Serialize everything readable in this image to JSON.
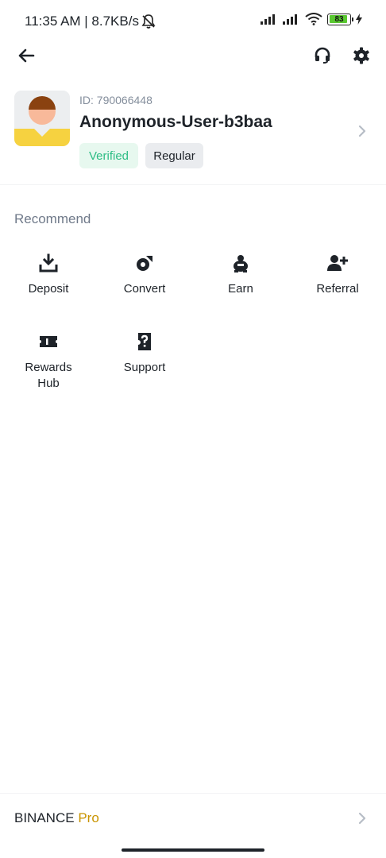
{
  "status_bar": {
    "time": "11:35 AM | 8.7KB/s",
    "battery_level": "83",
    "icons": [
      "mute-bell-icon",
      "signal-icon",
      "signal-icon",
      "wifi-icon",
      "battery-icon",
      "charging-icon"
    ]
  },
  "topbar": {
    "icons": [
      "back-arrow-icon",
      "headset-icon",
      "gear-icon"
    ]
  },
  "profile": {
    "id_text": "ID: 790066448",
    "username": "Anonymous-User-b3baa",
    "badges": [
      "Verified",
      "Regular"
    ]
  },
  "recommend": {
    "title": "Recommend",
    "items": [
      {
        "label": "Deposit",
        "icon": "deposit-icon"
      },
      {
        "label": "Convert",
        "icon": "convert-icon"
      },
      {
        "label": "Earn",
        "icon": "earn-icon"
      },
      {
        "label": "Referral",
        "icon": "referral-icon"
      },
      {
        "label": "Rewards\nHub",
        "icon": "rewards-hub-icon"
      },
      {
        "label": "Support",
        "icon": "support-icon"
      }
    ]
  },
  "footer": {
    "brand": "BINANCE",
    "brand_suffix": "Pro"
  },
  "colors": {
    "text_primary": "#1e2329",
    "text_secondary": "#707a8a",
    "verified_green": "#2ebd85",
    "brand_gold": "#c99400"
  }
}
